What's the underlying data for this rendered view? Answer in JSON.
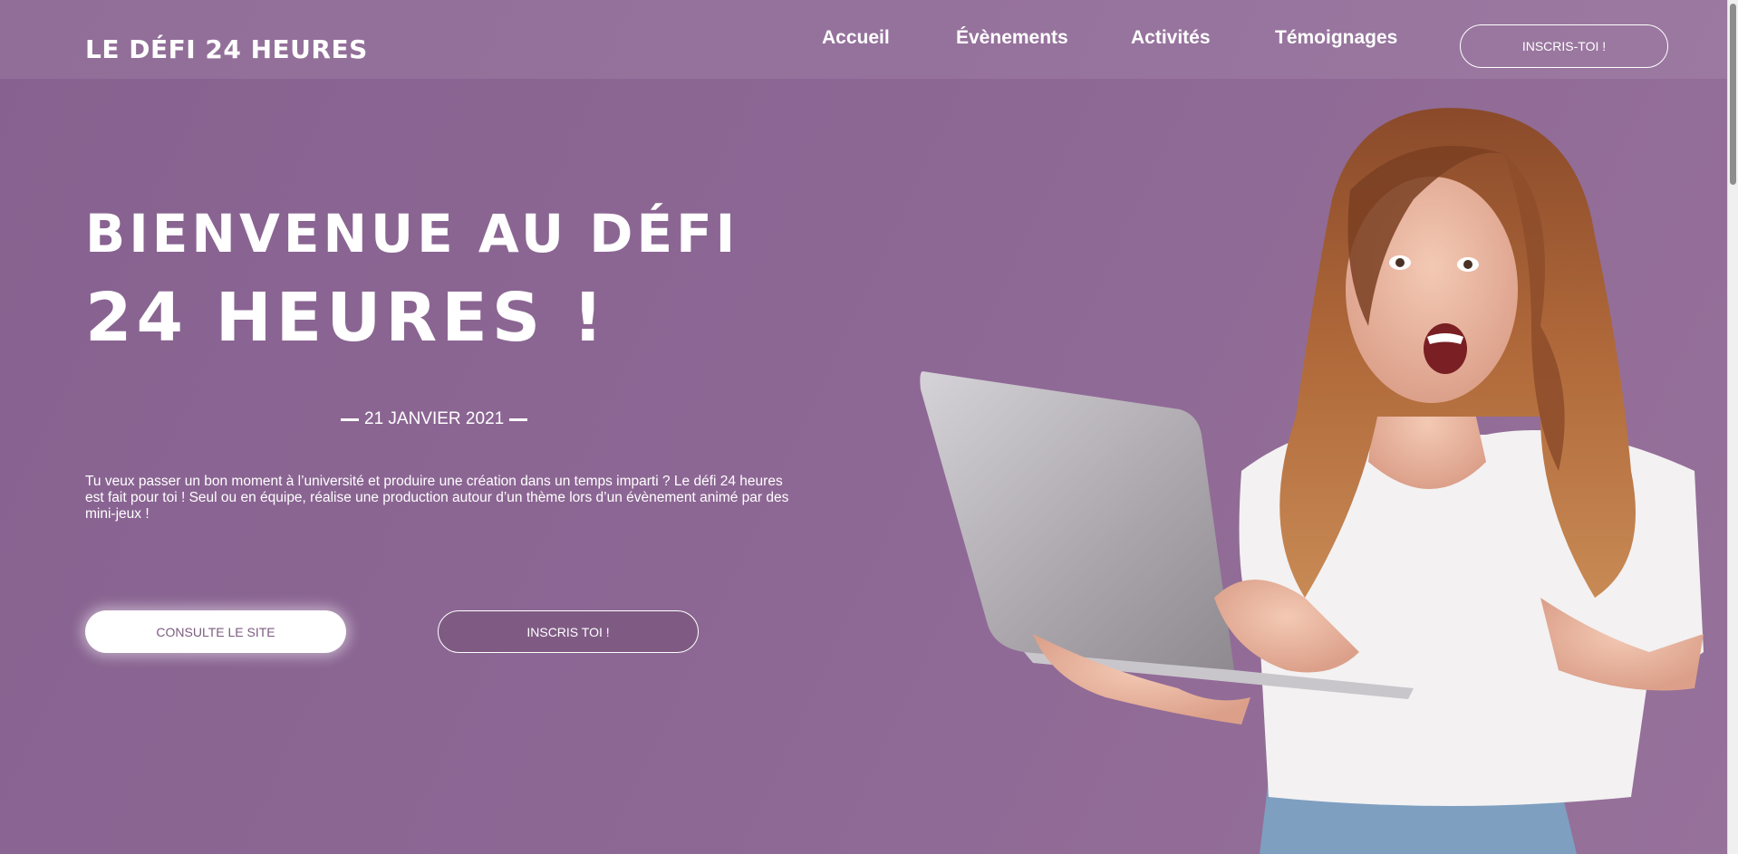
{
  "nav": {
    "logo": "LE DÉFI 24 HEURES",
    "links": [
      "Accueil",
      "Évènements",
      "Activités",
      "Témoignages"
    ],
    "cta": "INSCRIS-TOI !"
  },
  "hero": {
    "title_line1": "BIENVENUE AU DÉFI",
    "title_line2": "24 HEURES !",
    "date": "21 JANVIER 2021",
    "intro": "Tu veux passer un bon moment à l’université et produire une création dans un temps imparti ? Le défi 24 heures est fait pour toi ! Seul ou en équipe, réalise une production autour d’un thème lors d’un évènement animé par des mini-jeux !",
    "primary_button": "CONSULTE LE SITE",
    "secondary_button": "INSCRIS TOI !"
  },
  "colors": {
    "background": "#8b6590",
    "button_text": "#7d5a82",
    "text": "#ffffff"
  },
  "icons": [
    "woman-with-laptop-photo"
  ]
}
